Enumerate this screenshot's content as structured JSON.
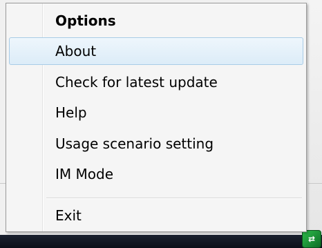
{
  "menu": {
    "header": "Options",
    "items": [
      {
        "label": "About",
        "selected": true
      },
      {
        "label": "Check for latest update"
      },
      {
        "label": "Help"
      },
      {
        "label": "Usage scenario setting"
      },
      {
        "label": "IM Mode"
      }
    ],
    "exit_label": "Exit",
    "highlight_color": "#dcecf8",
    "highlight_border": "#a8cbe6"
  },
  "tray": {
    "icon": "app-tray-icon",
    "accent": "#2dbb4a"
  }
}
